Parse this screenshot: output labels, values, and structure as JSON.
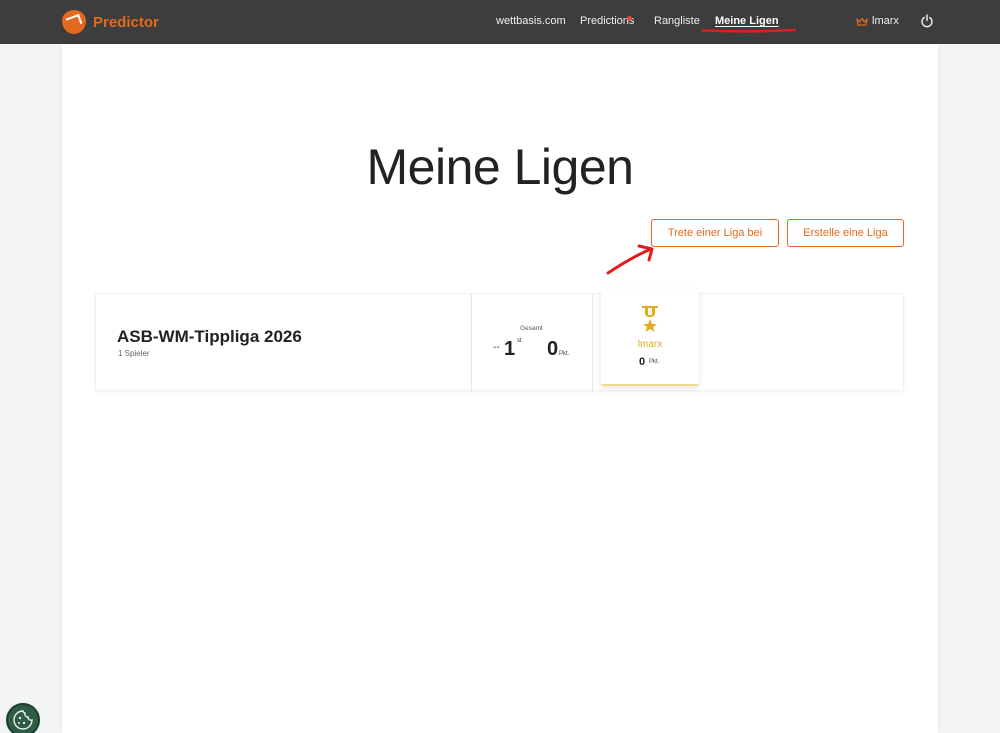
{
  "app": {
    "name": "Predictor"
  },
  "nav": {
    "items": [
      {
        "label": "wettbasis.com"
      },
      {
        "label": "Predictions"
      },
      {
        "label": "Rangliste"
      },
      {
        "label": "Meine Ligen"
      }
    ],
    "user_name": "lmarx"
  },
  "page": {
    "title": "Meine Ligen",
    "join_label": "Trete einer Liga bei",
    "create_label": "Erstelle eine Liga"
  },
  "league": {
    "name": "ASB-WM-Tippliga 2026",
    "players": "1 Spieler",
    "stat_label": "Gesamt",
    "trend": "--",
    "rank": "1",
    "rank_suffix": "st",
    "points": "0",
    "points_suffix": "Pkt.",
    "leader": {
      "name": "lmarx",
      "points": "0",
      "points_suffix": "Pkt."
    }
  },
  "colors": {
    "brand": "#e2691e",
    "navbar": "#3d3d3d",
    "gold": "#e2a91e",
    "annotation": "#e31c1c"
  },
  "icons": [
    "logo-icon",
    "crown-icon",
    "power-icon",
    "medal-icon",
    "cookie-icon"
  ]
}
